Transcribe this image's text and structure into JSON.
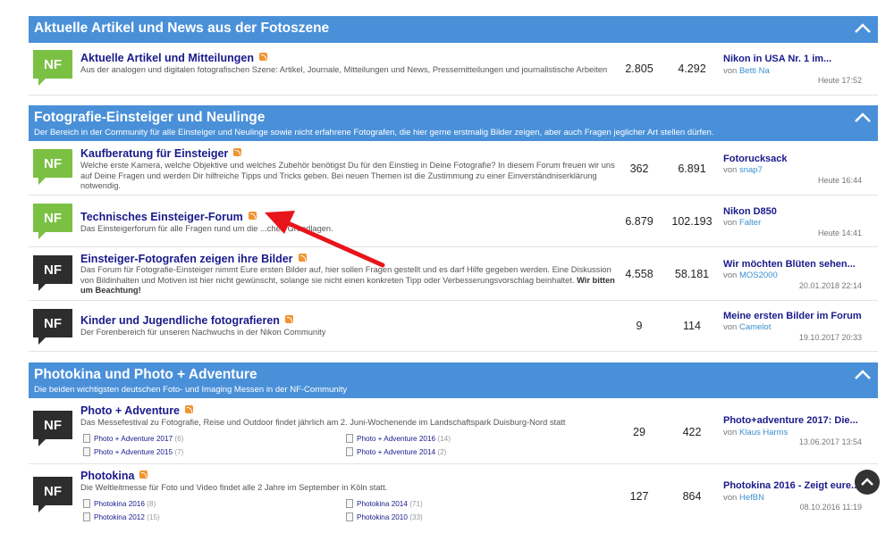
{
  "categories": [
    {
      "title": "Aktuelle Artikel und News aus der Fotoszene",
      "desc": ""
    },
    {
      "title": "Fotografie-Einsteiger und Neulinge",
      "desc": "Der Bereich in der Community für alle Einsteiger und Neulinge sowie nicht erfahrene Fotografen, die hier gerne erstmalig Bilder zeigen, aber auch Fragen jeglicher Art stellen dürfen."
    },
    {
      "title": "Photokina und Photo + Adventure",
      "desc": "Die beiden wichtigsten deutschen Foto- und Imaging Messen in der NF-Community"
    }
  ],
  "icon_text": "NF",
  "colors": {
    "accent": "#4a90d9",
    "green": "#7ac143",
    "dark": "#2d2d2d",
    "arrow": "#e8141b",
    "rss": "#f09331",
    "link": "#1a1a8c"
  },
  "forums": [
    {
      "title": "Aktuelle Artikel und Mitteilungen",
      "desc": "Aus der analogen und digitalen fotografischen Szene: Artikel, Journale, Mitteilungen und News, Pressemitteilungen und journalistische Arbeiten",
      "threads": "2.805",
      "posts": "4.292",
      "last_title": "Nikon in USA Nr. 1 im...",
      "by": "von",
      "last_user": "Betti Na",
      "last_time": "Heute 17:52"
    },
    {
      "title": "Kaufberatung für Einsteiger",
      "desc": "Welche erste Kamera, welche Objektive und welches Zubehör benötigst Du für den Einstieg in Deine Fotografie? In diesem Forum freuen wir uns auf Deine Fragen und werden Dir hilfreiche Tipps und Tricks geben. Bei neuen Themen ist die Zustimmung zu einer Einverständniserklärung notwendig.",
      "threads": "362",
      "posts": "6.891",
      "last_title": "Fotorucksack",
      "by": "von",
      "last_user": "snap7",
      "last_time": "Heute 16:44"
    },
    {
      "title": "Technisches Einsteiger-Forum",
      "desc": "Das Einsteigerforum für alle Fragen rund um die ...chen Grundlagen.",
      "threads": "6.879",
      "posts": "102.193",
      "last_title": "Nikon D850",
      "by": "von",
      "last_user": "Falter",
      "last_time": "Heute 14:41"
    },
    {
      "title": "Einsteiger-Fotografen zeigen ihre Bilder",
      "desc": "Das Forum für Fotografie-Einsteiger nimmt Eure ersten Bilder auf, hier sollen Fragen gestellt und es darf Hilfe gegeben werden. Eine Diskussion von Bildinhalten und Motiven ist hier nicht gewünscht, solange sie nicht einen konkreten Tipp oder Verbesserungsvorschlag beinhaltet.",
      "desc_bold": "Wir bitten um Beachtung!",
      "threads": "4.558",
      "posts": "58.181",
      "last_title": "Wir möchten Blüten sehen...",
      "by": "von",
      "last_user": "MOS2000",
      "last_time": "20.01.2018 22:14"
    },
    {
      "title": "Kinder und Jugendliche fotografieren",
      "desc": "Der Forenbereich für unseren Nachwuchs in der Nikon Community",
      "threads": "9",
      "posts": "114",
      "last_title": "Meine ersten Bilder im Forum",
      "by": "von",
      "last_user": "Camelot",
      "last_time": "19.10.2017 20:33"
    },
    {
      "title": "Photo + Adventure",
      "desc": "Das Messefestival zu Fotografie, Reise und Outdoor findet jährlich am 2. Juni-Wochenende im Landschaftspark Duisburg-Nord statt",
      "threads": "29",
      "posts": "422",
      "last_title": "Photo+adventure 2017: Die...",
      "by": "von",
      "last_user": "Klaus Harms",
      "last_time": "13.06.2017 13:54",
      "subforums": [
        {
          "name": "Photo + Adventure 2017",
          "count": "(6)"
        },
        {
          "name": "Photo + Adventure 2016",
          "count": "(14)"
        },
        {
          "name": "Photo + Adventure 2015",
          "count": "(7)"
        },
        {
          "name": "Photo + Adventure 2014",
          "count": "(2)"
        }
      ]
    },
    {
      "title": "Photokina",
      "desc": "Die Weltleitmesse für Foto und Video findet alle 2 Jahre im September in Köln statt.",
      "threads": "127",
      "posts": "864",
      "last_title": "Photokina 2016 - Zeigt eure...",
      "by": "von",
      "last_user": "HefBN",
      "last_time": "08.10.2016 11:19",
      "subforums": [
        {
          "name": "Photokina 2016",
          "count": "(8)"
        },
        {
          "name": "Photokina 2014",
          "count": "(71)"
        },
        {
          "name": "Photokina 2012",
          "count": "(15)"
        },
        {
          "name": "Photokina 2010",
          "count": "(33)"
        }
      ]
    }
  ]
}
